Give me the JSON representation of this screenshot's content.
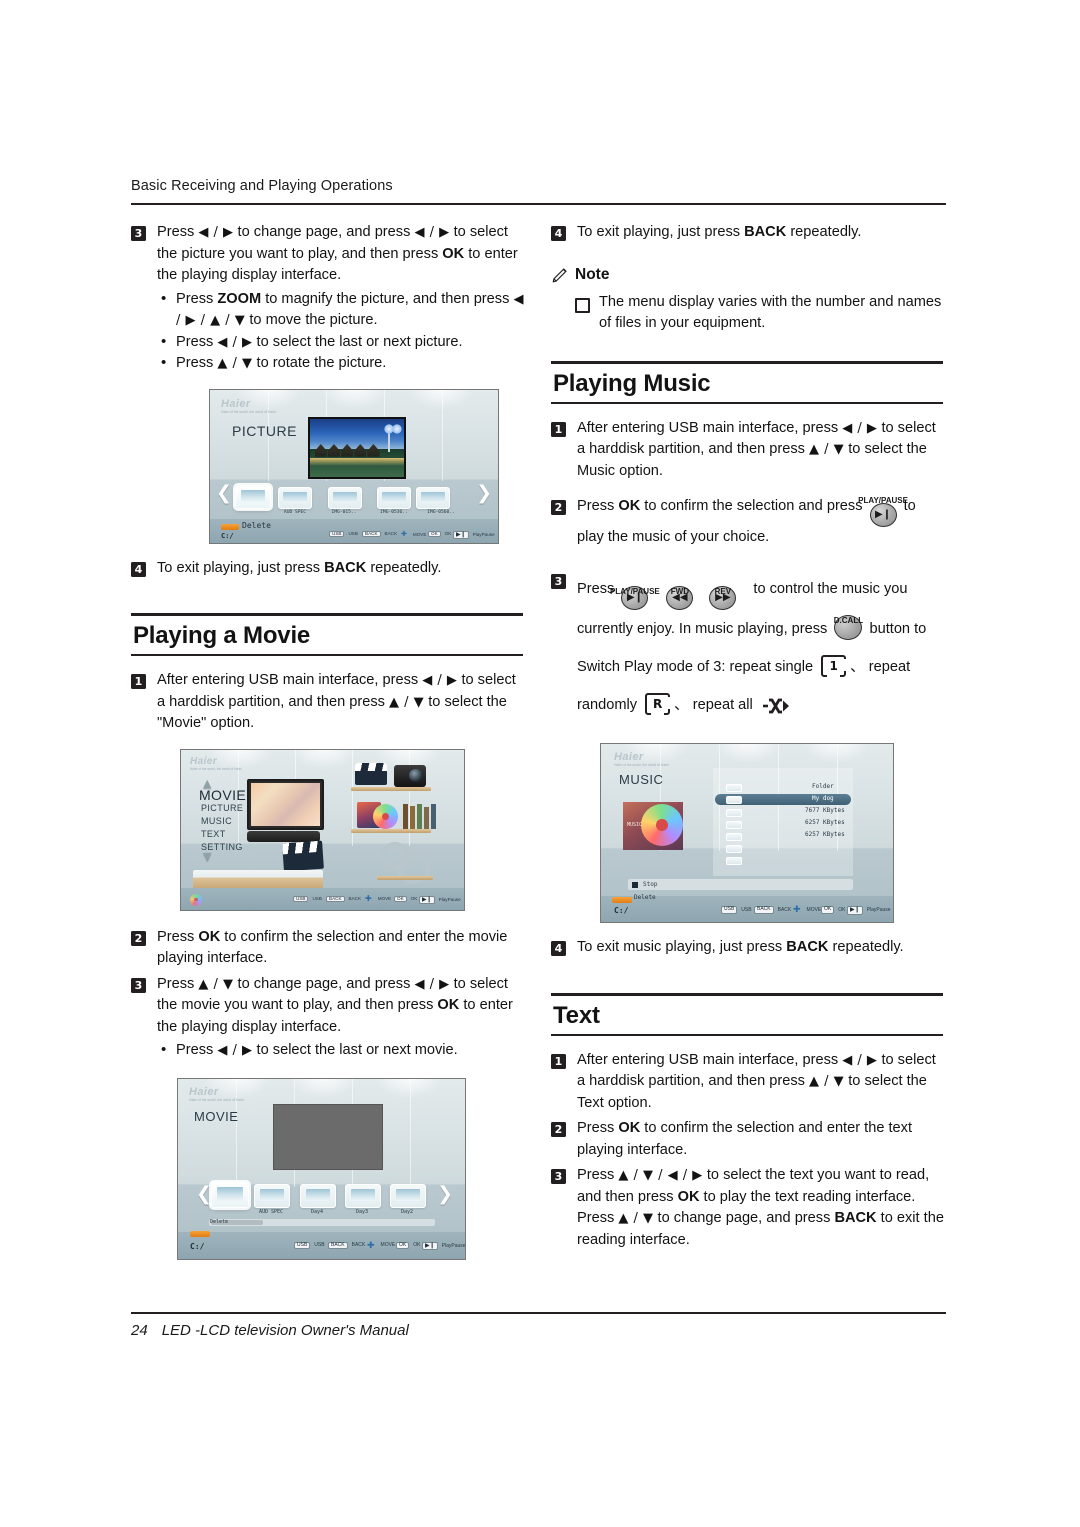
{
  "header": {
    "running_head": "Basic Receiving and Playing Operations"
  },
  "footer": {
    "page_number": "24",
    "manual_title": "LED -LCD television Owner's Manual"
  },
  "left_column": {
    "picture_step3": {
      "num": "3",
      "text_1": "Press ",
      "arrows_1": "◀ / ▶",
      "text_2": " to change page, and press ",
      "arrows_2": "◀ / ▶",
      "text_3": " to select the picture you want to play, and then press ",
      "bold_1": "OK",
      "text_4": " to enter the playing display interface.",
      "bullets": [
        {
          "pre": "Press ",
          "bold": "ZOOM",
          "mid": " to magnify the picture, and then press ",
          "arrows": "◀ / ▶ / ▲ / ▼",
          "post": " to move the picture."
        },
        {
          "pre": "Press ",
          "bold": "",
          "mid": "",
          "arrows": "◀ / ▶",
          "post": " to select the last or next picture."
        },
        {
          "pre": "Press ",
          "bold": "",
          "mid": "",
          "arrows": "▲ / ▼",
          "post": " to rotate the picture."
        }
      ]
    },
    "picture_step4": {
      "num": "4",
      "text_1": "To exit playing, just press ",
      "bold_1": "BACK",
      "text_2": " repeatedly."
    },
    "movie_section": {
      "title": "Playing a Movie",
      "step1": {
        "num": "1",
        "text_1": "After entering USB main interface, press ",
        "arrows_1": "◀ / ▶",
        "text_2": " to select a harddisk partition, and then press ",
        "arrows_2": "▲ / ▼",
        "text_3": " to select the \"Movie\" option."
      },
      "step2": {
        "num": "2",
        "text_1": "Press ",
        "bold_1": "OK",
        "text_2": " to confirm the selection and enter the movie playing interface."
      },
      "step3": {
        "num": "3",
        "text_1": "Press ",
        "arrows_1": "▲ / ▼",
        "text_2": " to change page, and press ",
        "arrows_2": "◀ / ▶",
        "text_3": " to select the movie you want to play, and then press ",
        "bold_1": "OK",
        "text_4": " to enter the playing display interface.",
        "bullet": {
          "pre": "Press ",
          "arrows": "◀ / ▶",
          "post": " to select the last or next movie."
        }
      }
    }
  },
  "right_column": {
    "picture_step4": {
      "num": "4",
      "text_1": "To exit playing, just press ",
      "bold_1": "BACK",
      "text_2": " repeatedly."
    },
    "note": {
      "label": "Note",
      "items": [
        "The menu display varies with the number and names of files in your equipment."
      ]
    },
    "music_section": {
      "title": "Playing Music",
      "step1": {
        "num": "1",
        "text_1": "After entering USB main interface, press ",
        "arrows_1": "◀ / ▶",
        "text_2": " to select a harddisk partition, and then press ",
        "arrows_2": "▲ / ▼",
        "text_3": " to select the Music option."
      },
      "step2": {
        "num": "2",
        "text_1": "Press ",
        "bold_1": "OK",
        "text_2": " to confirm the selection and press ",
        "key_label": "PLAY/PAUSE",
        "key_glyph": "▶❙",
        "text_3": " to play the music of your choice."
      },
      "step3": {
        "num": "3",
        "text_1": "Press ",
        "key1_label": "PLAY/PAUSE",
        "key1_glyph": "▶❙",
        "key2_label": "FWD",
        "key2_glyph": "◀◀",
        "key3_label": "REV",
        "key3_glyph": "▶▶",
        "text_2": " to control the music you currently enjoy. In music playing, press ",
        "key4_label": "D.CALL",
        "text_3": " button to Switch Play mode of 3: repeat single ",
        "mode1": "1",
        "sep1": "、",
        "text_4": " repeat randomly ",
        "mode2": "R",
        "sep2": "、",
        "text_5": " repeat all ",
        "mode3": "N"
      },
      "step4": {
        "num": "4",
        "text_1": "To exit music playing, just press ",
        "bold_1": "BACK",
        "text_2": " repeatedly."
      }
    },
    "text_section": {
      "title": "Text",
      "step1": {
        "num": "1",
        "text_1": "After entering USB main interface, press ",
        "arrows_1": "◀ / ▶",
        "text_2": " to select a harddisk partition, and then press ",
        "arrows_2": "▲ / ▼",
        "text_3": " to select the Text option."
      },
      "step2": {
        "num": "2",
        "text_1": "Press ",
        "bold_1": "OK",
        "text_2": " to confirm the selection and enter the text playing interface."
      },
      "step3": {
        "num": "3",
        "text_1": "Press ",
        "arrows_1": "▲ / ▼ / ◀ / ▶",
        "text_2": " to select the text you want to read, and then press ",
        "bold_1": "OK",
        "text_3": " to play the text reading interface. Press ",
        "arrows_2": "▲ / ▼",
        "text_4": " to change page, and press ",
        "bold_2": "BACK",
        "text_5": " to exit the reading interface."
      }
    }
  },
  "screenshots": {
    "picture_list": {
      "brand": "Haier",
      "brand_sub": "Haier of the world, the world of Haier",
      "title": "PICTURE",
      "thumb_labels": [
        "",
        "AUD SPEC",
        "IMG-015..",
        "IMG-0536..",
        "IMG-0560.."
      ],
      "delete_label": "Delete",
      "drive": "C:/",
      "hints": [
        {
          "key": "USB",
          "text": "USB"
        },
        {
          "key": "BACK",
          "text": "BACK"
        },
        {
          "key": "✚",
          "text": "MOVE"
        },
        {
          "key": "OK",
          "text": "OK"
        },
        {
          "key": "▶❙",
          "text": "PlayPause"
        }
      ]
    },
    "movie_menu": {
      "brand": "Haier",
      "brand_sub": "Haier of the world, the world of Haier",
      "menu": [
        "MOVIE",
        "PICTURE",
        "MUSIC",
        "TEXT",
        "SETTING"
      ],
      "hints": [
        {
          "key": "USB",
          "text": "USB"
        },
        {
          "key": "BACK",
          "text": "BACK"
        },
        {
          "key": "✚",
          "text": "MOVE"
        },
        {
          "key": "OK",
          "text": "OK"
        },
        {
          "key": "▶❙",
          "text": "PlayPause"
        }
      ]
    },
    "movie_list": {
      "brand": "Haier",
      "brand_sub": "Haier of the world, the world of Haier",
      "title": "MOVIE",
      "thumb_labels": [
        "",
        "AUD SPEC",
        "Day4",
        "Day3",
        "Day2"
      ],
      "delete_label": "Delete",
      "drive": "C:/",
      "hints": [
        {
          "key": "USB",
          "text": "USB"
        },
        {
          "key": "BACK",
          "text": "BACK"
        },
        {
          "key": "✚",
          "text": "MOVE"
        },
        {
          "key": "OK",
          "text": "OK"
        },
        {
          "key": "▶❙",
          "text": "PlayPause"
        }
      ]
    },
    "music_list": {
      "brand": "Haier",
      "brand_sub": "Haier of the world, the world of Haier",
      "title": "MUSIC",
      "album_label": "MUSIC",
      "rows": [
        "Folder",
        "My dog",
        "7677 KBytes",
        "6257 KBytes",
        "6257 KBytes"
      ],
      "selected_row": "My dog",
      "stop_label": "Stop",
      "delete_label": "Delete",
      "drive": "C:/",
      "hints": [
        {
          "key": "USB",
          "text": "USB"
        },
        {
          "key": "BACK",
          "text": "BACK"
        },
        {
          "key": "✚",
          "text": "MOVE"
        },
        {
          "key": "OK",
          "text": "OK"
        },
        {
          "key": "▶❙",
          "text": "PlayPause"
        }
      ]
    }
  }
}
